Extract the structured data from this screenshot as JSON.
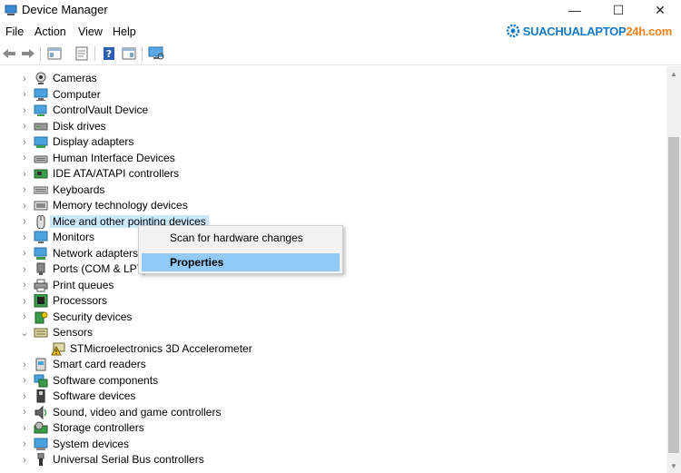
{
  "window": {
    "title": "Device Manager",
    "minimize_glyph": "—",
    "maximize_glyph": "☐",
    "close_glyph": "✕"
  },
  "menu": [
    "File",
    "Action",
    "View",
    "Help"
  ],
  "brand": {
    "text_main": "SUACHUALAPTOP",
    "text_accent": "24h.com",
    "icon": "gear-logo-icon"
  },
  "toolbar": {
    "icons": [
      "back-arrow-icon",
      "forward-arrow-icon",
      "show-hide-console-tree-icon",
      "properties-icon",
      "help-icon",
      "action-pane-icon",
      "monitor-scan-icon"
    ]
  },
  "tree": {
    "items": [
      {
        "label": "Cameras",
        "icon": "camera-icon",
        "state": "collapsed"
      },
      {
        "label": "Computer",
        "icon": "computer-icon",
        "state": "collapsed"
      },
      {
        "label": "ControlVault Device",
        "icon": "controlvault-icon",
        "state": "collapsed"
      },
      {
        "label": "Disk drives",
        "icon": "disk-drive-icon",
        "state": "collapsed"
      },
      {
        "label": "Display adapters",
        "icon": "display-adapter-icon",
        "state": "collapsed"
      },
      {
        "label": "Human Interface Devices",
        "icon": "hid-icon",
        "state": "collapsed"
      },
      {
        "label": "IDE ATA/ATAPI controllers",
        "icon": "ide-controller-icon",
        "state": "collapsed"
      },
      {
        "label": "Keyboards",
        "icon": "keyboard-icon",
        "state": "collapsed"
      },
      {
        "label": "Memory technology devices",
        "icon": "memory-icon",
        "state": "collapsed"
      },
      {
        "label": "Mice and other pointing devices",
        "icon": "mouse-icon",
        "state": "collapsed"
      },
      {
        "label": "Monitors",
        "icon": "monitor-icon",
        "state": "collapsed"
      },
      {
        "label": "Network adapters",
        "icon": "network-adapter-icon",
        "state": "collapsed"
      },
      {
        "label": "Ports (COM & LPT)",
        "icon": "port-icon",
        "state": "collapsed"
      },
      {
        "label": "Print queues",
        "icon": "printer-icon",
        "state": "collapsed"
      },
      {
        "label": "Processors",
        "icon": "processor-icon",
        "state": "collapsed"
      },
      {
        "label": "Security devices",
        "icon": "security-device-icon",
        "state": "collapsed"
      },
      {
        "label": "Sensors",
        "icon": "sensor-icon",
        "state": "expanded"
      },
      {
        "label": "STMicroelectronics 3D Accelerometer",
        "icon": "warning-device-icon",
        "state": "child"
      },
      {
        "label": "Smart card readers",
        "icon": "smart-card-icon",
        "state": "collapsed"
      },
      {
        "label": "Software components",
        "icon": "software-component-icon",
        "state": "collapsed"
      },
      {
        "label": "Software devices",
        "icon": "software-device-icon",
        "state": "collapsed"
      },
      {
        "label": "Sound, video and game controllers",
        "icon": "sound-icon",
        "state": "collapsed"
      },
      {
        "label": "Storage controllers",
        "icon": "storage-controller-icon",
        "state": "collapsed"
      },
      {
        "label": "System devices",
        "icon": "system-device-icon",
        "state": "collapsed"
      },
      {
        "label": "Universal Serial Bus controllers",
        "icon": "usb-icon",
        "state": "collapsed"
      }
    ],
    "selected_index": 9
  },
  "context_menu": {
    "items": [
      {
        "label": "Scan for hardware changes",
        "highlighted": false
      },
      {
        "label": "Properties",
        "highlighted": true
      }
    ]
  },
  "colors": {
    "selection": "#cce8ff",
    "menu_highlight": "#91c9f7",
    "brand_blue": "#1478c8",
    "brand_orange": "#f4811f",
    "warning_yellow": "#f5c400"
  }
}
